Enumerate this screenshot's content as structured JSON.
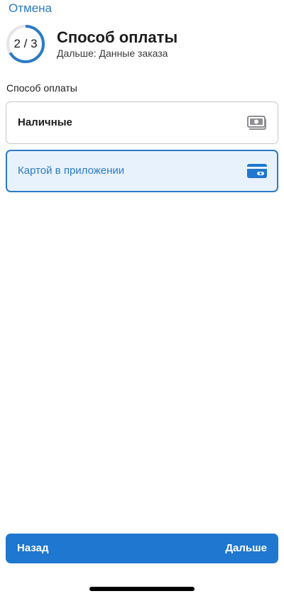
{
  "nav": {
    "cancel_label": "Отмена"
  },
  "header": {
    "step_label": "2 / 3",
    "step_current": 2,
    "step_total": 3,
    "title": "Способ оплаты",
    "subtitle": "Дальше: Данные заказа"
  },
  "payment": {
    "section_label": "Способ оплаты",
    "options": [
      {
        "label": "Наличные",
        "icon": "cash-icon",
        "selected": false
      },
      {
        "label": "Картой в приложении",
        "icon": "credit-card-icon",
        "selected": true
      }
    ]
  },
  "footer": {
    "back_label": "Назад",
    "next_label": "Дальше"
  },
  "colors": {
    "accent": "#2b7bc6",
    "button": "#1f77cf",
    "selected_bg": "#e8f2fc",
    "progress_track": "#e5e5ea"
  }
}
